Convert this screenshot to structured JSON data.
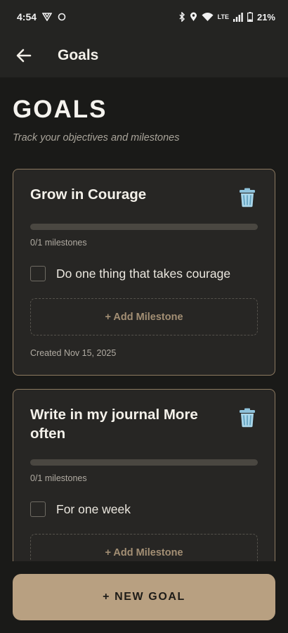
{
  "status_bar": {
    "time": "4:54",
    "battery": "21%",
    "network": "LTE"
  },
  "app_bar": {
    "title": "Goals"
  },
  "page": {
    "heading": "GOALS",
    "subtitle": "Track your objectives and milestones"
  },
  "goals": [
    {
      "title": "Grow in Courage",
      "milestones_completed": 0,
      "milestones_total": 1,
      "progress": "0/1 milestones",
      "milestones": [
        {
          "text": "Do one thing that takes courage",
          "done": false
        }
      ],
      "add_milestone_label": "+ Add Milestone",
      "created": "Created Nov 15, 2025"
    },
    {
      "title": "Write in my journal More often",
      "milestones_completed": 0,
      "milestones_total": 1,
      "progress": "0/1 milestones",
      "milestones": [
        {
          "text": "For one week",
          "done": false
        }
      ],
      "add_milestone_label": "+ Add Milestone"
    }
  ],
  "new_goal_label": "+ NEW GOAL",
  "colors": {
    "background": "#1a1a18",
    "card": "#272624",
    "card_border": "#8c7a61",
    "accent": "#b8a081"
  },
  "icons": [
    "back-arrow-icon",
    "trash-icon",
    "wifi-icon",
    "bluetooth-icon",
    "battery-icon"
  ]
}
